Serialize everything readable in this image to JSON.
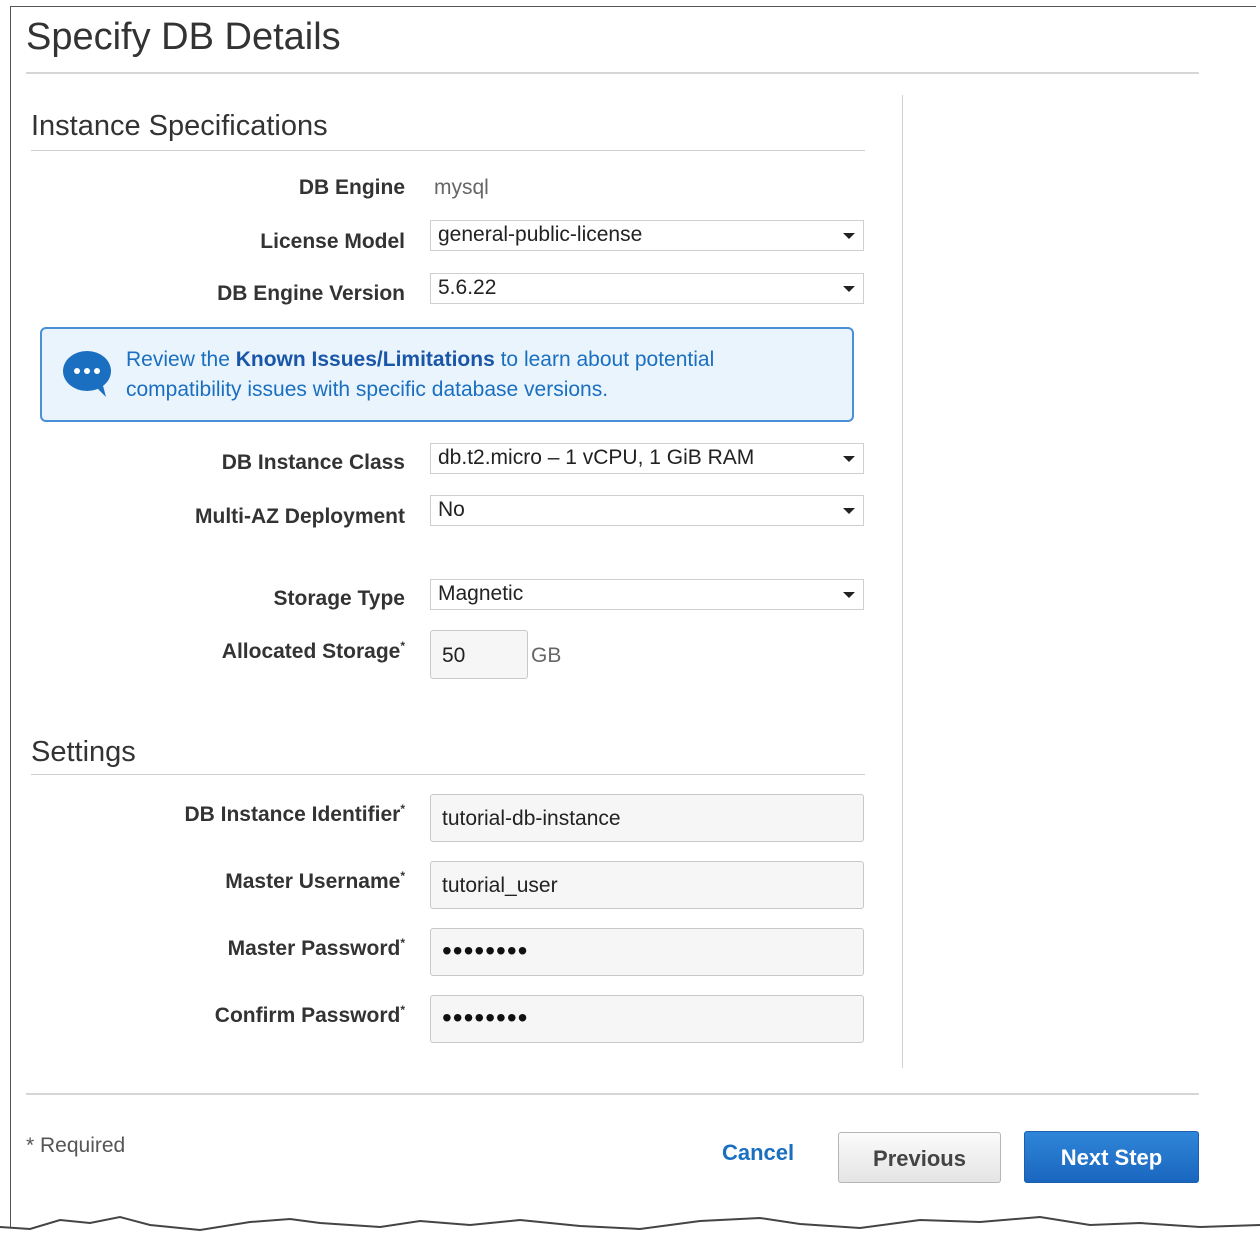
{
  "page": {
    "title": "Specify DB Details"
  },
  "instance_specifications": {
    "title": "Instance Specifications",
    "db_engine": {
      "label": "DB Engine",
      "value": "mysql"
    },
    "license_model": {
      "label": "License Model",
      "value": "general-public-license"
    },
    "db_engine_version": {
      "label": "DB Engine Version",
      "value": "5.6.22"
    },
    "alert": {
      "prefix": "Review the ",
      "link": "Known Issues/Limitations",
      "suffix": " to learn about potential compatibility issues with specific database versions."
    },
    "db_instance_class": {
      "label": "DB Instance Class",
      "value": "db.t2.micro – 1 vCPU, 1 GiB RAM"
    },
    "multi_az": {
      "label": "Multi-AZ Deployment",
      "value": "No"
    },
    "storage_type": {
      "label": "Storage Type",
      "value": "Magnetic"
    },
    "allocated_storage": {
      "label": "Allocated Storage",
      "value": "50",
      "unit": "GB"
    }
  },
  "settings": {
    "title": "Settings",
    "db_instance_identifier": {
      "label": "DB Instance Identifier",
      "value": "tutorial-db-instance"
    },
    "master_username": {
      "label": "Master Username",
      "value": "tutorial_user"
    },
    "master_password": {
      "label": "Master Password",
      "value": "••••••••"
    },
    "confirm_password": {
      "label": "Confirm Password",
      "value": "••••••••"
    }
  },
  "footer": {
    "required_note": "* Required",
    "cancel_label": "Cancel",
    "previous_label": "Previous",
    "next_label": "Next Step"
  },
  "colors": {
    "accent": "#1a6fc1",
    "primary_button": "#1a66bf",
    "alert_border": "#4a90d9",
    "alert_bg": "#eaf4fd"
  },
  "icons": {
    "alert_icon": "speech-bubble-icon",
    "dropdown_icon": "caret-down-icon"
  }
}
